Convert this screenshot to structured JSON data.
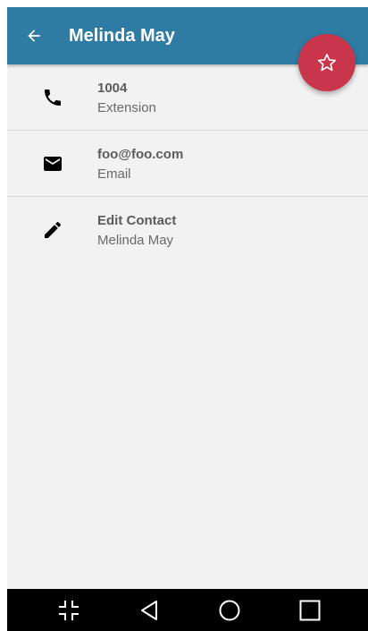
{
  "appbar": {
    "title": "Melinda May",
    "back_icon": "arrow-back-icon",
    "background": "#2e7ba3"
  },
  "fab": {
    "icon": "star-outline-icon",
    "color": "#c9354a"
  },
  "contact_rows": [
    {
      "icon": "phone-icon",
      "primary": "1004",
      "secondary": "Extension"
    },
    {
      "icon": "email-icon",
      "primary": "foo@foo.com",
      "secondary": "Email"
    },
    {
      "icon": "edit-icon",
      "primary": "Edit Contact",
      "secondary": "Melinda May"
    }
  ],
  "navbar": {
    "buttons": [
      "collapse-icon",
      "back-triangle-icon",
      "home-circle-icon",
      "recents-square-icon"
    ]
  }
}
